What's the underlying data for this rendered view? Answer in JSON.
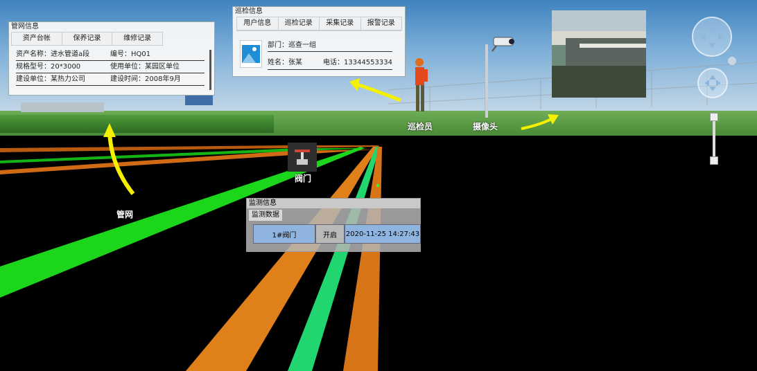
{
  "pipe_panel": {
    "title": "管网信息",
    "tabs": [
      "资产台帐",
      "保养记录",
      "维修记录"
    ],
    "rows": [
      {
        "left": "资产名称：进水管道a段",
        "right": "编号：HQ01"
      },
      {
        "left": "规格型号：20*3000",
        "right": "使用单位：某园区单位"
      },
      {
        "left": "建设单位：某热力公司",
        "right": "建设时间：2008年9月"
      }
    ]
  },
  "patrol_panel": {
    "title": "巡检信息",
    "tabs": [
      "用户信息",
      "巡检记录",
      "采集记录",
      "报警记录"
    ],
    "department": "部门：巡查一组",
    "name": "姓名：张某",
    "phone": "电话：13344553334"
  },
  "monitor_panel": {
    "title": "监测信息",
    "tab": "监测数据",
    "cells": [
      "1#阀门",
      "开启",
      "2020-11-25 14:27:43"
    ]
  },
  "labels": {
    "pipe": "管网",
    "valve": "阀门",
    "patrol": "巡检员",
    "camera": "摄像头"
  },
  "colors": {
    "pipe_green": "#1bd61b",
    "pipe_orange": "#e0801a",
    "arrow_yellow": "#f5f000"
  }
}
